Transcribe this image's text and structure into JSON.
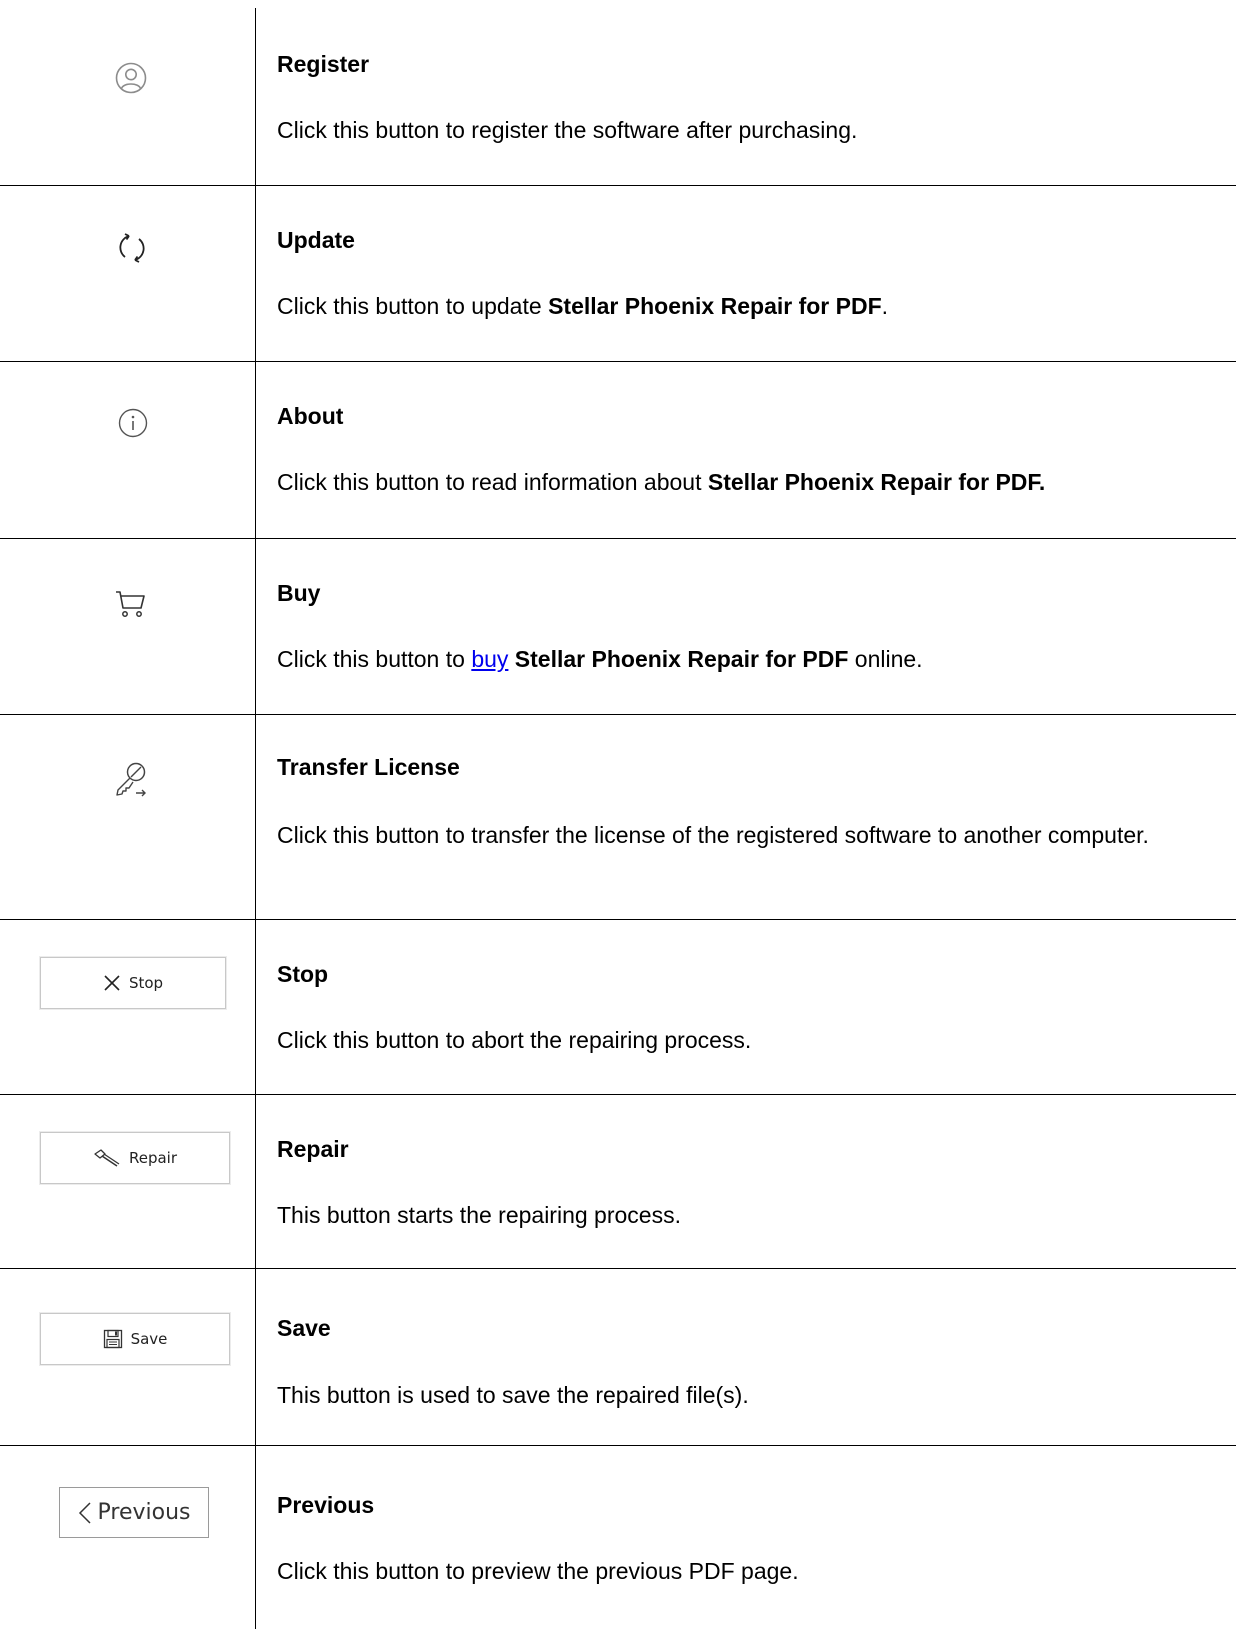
{
  "rows": [
    {
      "icon": "user-circle-icon",
      "title": "Register",
      "desc": "Click this button to register the software after purchasing."
    },
    {
      "icon": "refresh-icon",
      "title": "Update",
      "desc_pre": "Click this button to update ",
      "desc_bold": "Stellar Phoenix Repair for PDF",
      "desc_post": "."
    },
    {
      "icon": "info-icon",
      "title": "About",
      "desc_pre": "Click this button to read information about ",
      "desc_bold": "Stellar Phoenix Repair for PDF."
    },
    {
      "icon": "cart-icon",
      "title": "Buy",
      "desc_pre": "Click this button to ",
      "desc_link": "buy",
      "desc_bold": "Stellar Phoenix Repair for PDF",
      "desc_post": " online."
    },
    {
      "icon": "key-transfer-icon",
      "title": "Transfer License",
      "desc": "Click this button to transfer the license of the registered software to another computer."
    },
    {
      "icon": "close-icon",
      "button_label": "Stop",
      "title": "Stop",
      "desc": "Click this button to abort the repairing process."
    },
    {
      "icon": "hammer-icon",
      "button_label": "Repair",
      "title": "Repair",
      "desc": "This button starts the repairing process."
    },
    {
      "icon": "floppy-disk-icon",
      "button_label": "Save",
      "title": "Save",
      "desc": "This button is used to save the repaired file(s)."
    },
    {
      "icon": "chevron-left-icon",
      "button_label": "Previous",
      "title": "Previous",
      "desc": "Click this button to preview the previous PDF page."
    }
  ]
}
